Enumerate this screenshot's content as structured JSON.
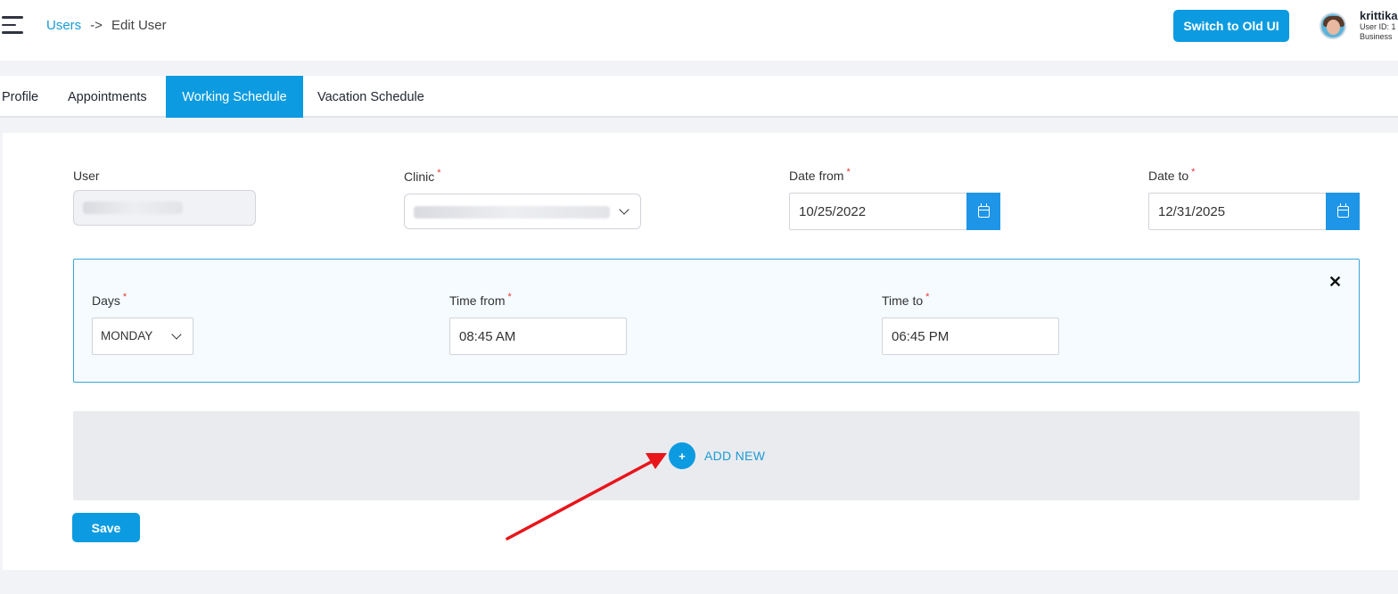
{
  "header": {
    "breadcrumb": {
      "link": "Users",
      "separator": "->",
      "current": "Edit User"
    },
    "switch_label": "Switch to Old UI",
    "user": {
      "name": "krittika",
      "id_line": "User ID: 1",
      "business_line": "Business"
    }
  },
  "tabs": [
    {
      "label": "Profile",
      "active": false
    },
    {
      "label": "Appointments",
      "active": false
    },
    {
      "label": "Working Schedule",
      "active": true
    },
    {
      "label": "Vacation Schedule",
      "active": false
    }
  ],
  "form": {
    "user_label": "User",
    "clinic_label": "Clinic",
    "date_from_label": "Date from",
    "date_from_value": "10/25/2022",
    "date_to_label": "Date to",
    "date_to_value": "12/31/2025",
    "required_mark": "*"
  },
  "schedule": {
    "days_label": "Days",
    "days_value": "MONDAY",
    "time_from_label": "Time from",
    "time_from_value": "08:45 AM",
    "time_to_label": "Time to",
    "time_to_value": "06:45 PM",
    "close_glyph": "✕"
  },
  "add_new": {
    "icon_glyph": "+",
    "label": "ADD NEW"
  },
  "save_label": "Save",
  "colors": {
    "accent": "#0c9be0",
    "calendar_button": "#1e95e6",
    "annotation_arrow": "#e8151b"
  },
  "icons": [
    "hamburger-icon",
    "calendar-icon",
    "chevron-down-icon",
    "close-icon",
    "plus-icon"
  ]
}
